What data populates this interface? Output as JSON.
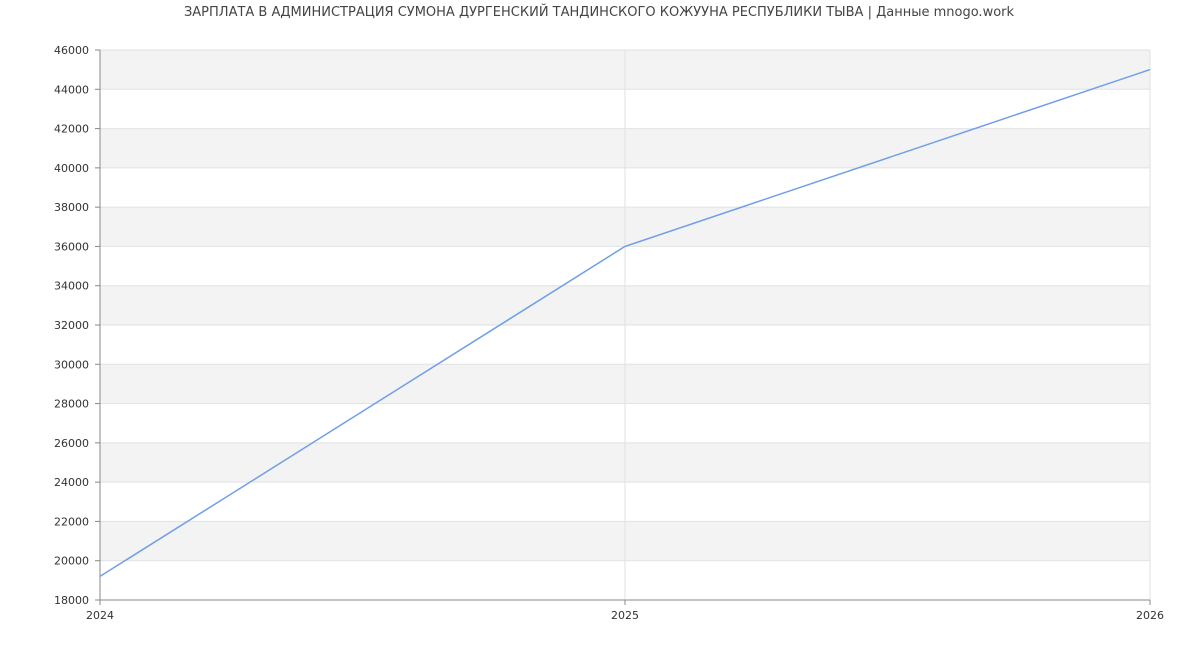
{
  "chart_data": {
    "type": "line",
    "title": "ЗАРПЛАТА В АДМИНИСТРАЦИЯ СУМОНА ДУРГЕНСКИЙ ТАНДИНСКОГО КОЖУУНА РЕСПУБЛИКИ ТЫВА | Данные mnogo.work",
    "x": [
      2024,
      2025,
      2026
    ],
    "series": [
      {
        "values": [
          19200,
          36000,
          45000
        ]
      }
    ],
    "xlim": [
      2024,
      2026
    ],
    "ylim": [
      18000,
      46000
    ],
    "yticks": [
      18000,
      20000,
      22000,
      24000,
      26000,
      28000,
      30000,
      32000,
      34000,
      36000,
      38000,
      40000,
      42000,
      44000,
      46000
    ],
    "xticks": [
      2024,
      2025,
      2026
    ],
    "grid": true,
    "colors": {
      "line": "#6f9fea",
      "band": "#f3f3f3",
      "grid": "#e2e2e2",
      "axis": "#888888"
    }
  }
}
